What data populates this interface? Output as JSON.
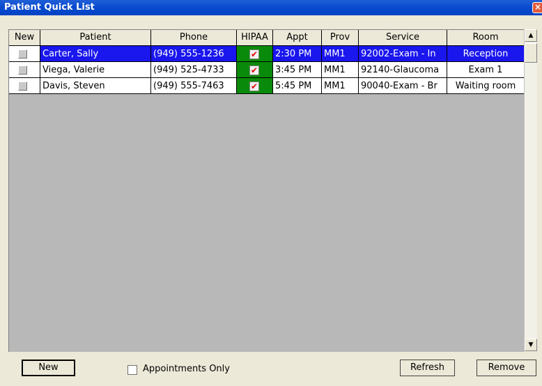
{
  "window": {
    "title": "Patient Quick List",
    "close_glyph": "×"
  },
  "table": {
    "headers": [
      "New",
      "Patient",
      "Phone",
      "HIPAA",
      "Appt",
      "Prov",
      "Service",
      "Room"
    ],
    "rows": [
      {
        "patient": "Carter, Sally",
        "phone": "(949) 555-1236",
        "hipaa": "✔",
        "appt": "2:30 PM",
        "prov": "MM1",
        "service": "92002-Exam - In",
        "room": "Reception",
        "selected": true
      },
      {
        "patient": "Viega, Valerie",
        "phone": "(949) 525-4733",
        "hipaa": "✔",
        "appt": "3:45 PM",
        "prov": "MM1",
        "service": "92140-Glaucoma",
        "room": "Exam 1",
        "selected": false
      },
      {
        "patient": "Davis, Steven",
        "phone": "(949) 555-7463",
        "hipaa": "✔",
        "appt": "5:45 PM",
        "prov": "MM1",
        "service": "90040-Exam - Br",
        "room": "Waiting room",
        "selected": false
      }
    ]
  },
  "scrollbar": {
    "up": "▲",
    "down": "▼"
  },
  "footer": {
    "new_label": "New",
    "appointments_only_label": "Appointments Only",
    "refresh_label": "Refresh",
    "remove_label": "Remove"
  },
  "colors": {
    "title_bar": "#0a4bd0",
    "selection": "#1a16ee",
    "hipaa_cell": "#0a8a0a",
    "list_background": "#b8b8b8"
  }
}
